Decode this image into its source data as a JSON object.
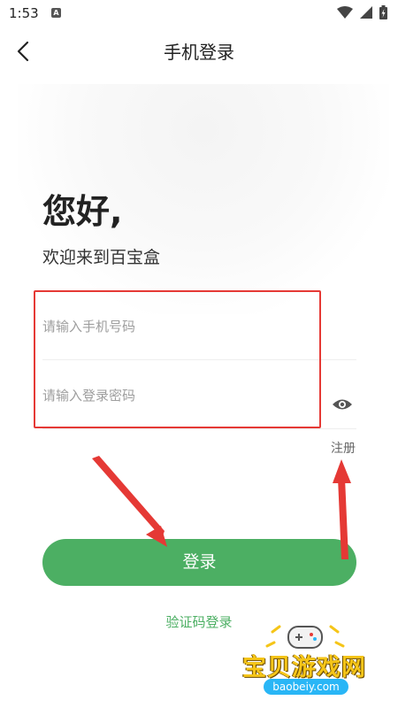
{
  "status_bar": {
    "time": "1:53",
    "notification_glyph": "A"
  },
  "header": {
    "title": "手机登录",
    "back_icon": "chevron-left-icon"
  },
  "greeting": {
    "title": "您好,",
    "subtitle": "欢迎来到百宝盒"
  },
  "form": {
    "phone_placeholder": "请输入手机号码",
    "password_placeholder": "请输入登录密码",
    "register_label": "注册",
    "login_button": "登录",
    "sms_login_label": "验证码登录"
  },
  "watermark": {
    "title": "宝贝游戏网",
    "url": "baobeiy.com"
  },
  "colors": {
    "accent": "#4caf63",
    "annotation": "#e53935"
  }
}
